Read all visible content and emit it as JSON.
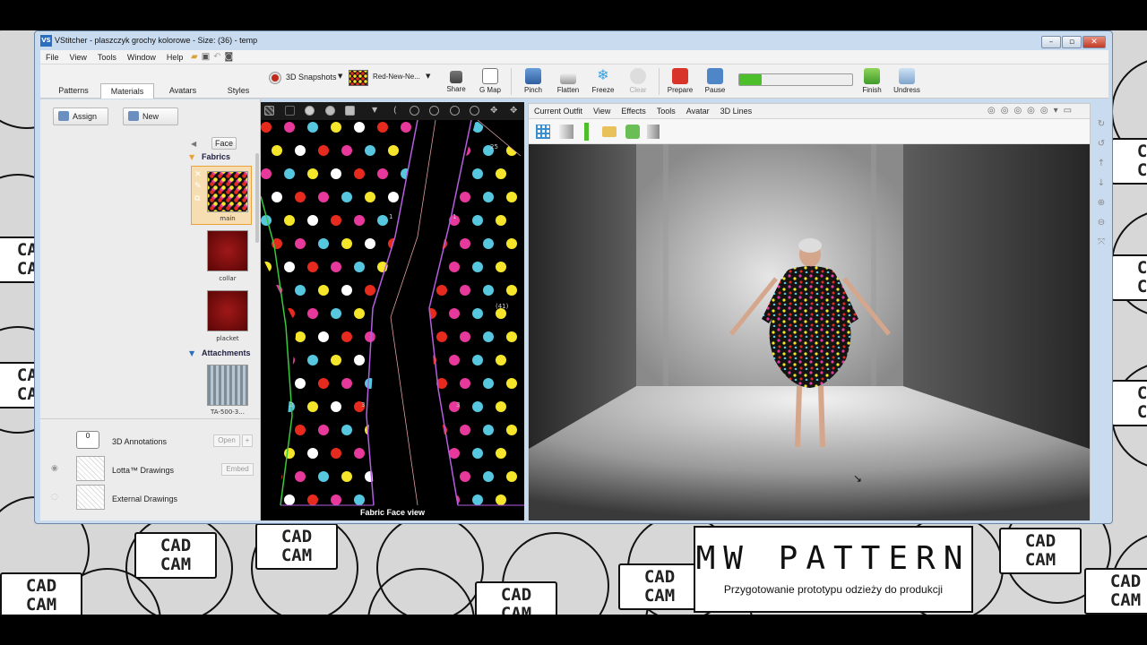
{
  "window": {
    "title": "VStitcher - plaszczyk grochy kolorowe - Size: (36) - temp",
    "icon": "VS"
  },
  "menu": [
    "File",
    "View",
    "Tools",
    "Window",
    "Help"
  ],
  "tabs": [
    "Patterns",
    "Materials",
    "Avatars",
    "Styles"
  ],
  "toolbar": {
    "snapshots": "3D Snapshots",
    "fabric_select": "Red-New-Ne...",
    "share": "Share",
    "gmap": "G Map",
    "pinch": "Pinch",
    "flatten": "Flatten",
    "freeze": "Freeze",
    "clear": "Clear",
    "prepare": "Prepare",
    "pause": "Pause",
    "finish": "Finish",
    "undress": "Undress",
    "progress": 0.2
  },
  "materials": {
    "assign": "Assign",
    "new": "New",
    "face": "Face",
    "fabrics_header": "Fabrics",
    "fabrics": [
      "main",
      "collar",
      "placket"
    ],
    "attachments_header": "Attachments",
    "attachment_label": "TA-500-3...",
    "annotations": {
      "label": "3D Annotations",
      "count": "0",
      "open": "Open",
      "plus": "+"
    },
    "lotta": {
      "label": "Lotta™ Drawings",
      "embed": "Embed"
    },
    "external": {
      "label": "External Drawings"
    }
  },
  "pattern_view": {
    "caption": "Fabric Face view",
    "nums": [
      "1",
      "2",
      "3",
      "1",
      "1",
      "3",
      "25",
      "(41)"
    ]
  },
  "view3d_menu": [
    "Current Outfit",
    "View",
    "Effects",
    "Tools",
    "Avatar",
    "3D Lines"
  ],
  "brand": {
    "title": "MW PATTERN",
    "subtitle": "Przygotowanie prototypu odzieży do produkcji"
  },
  "background_monitors": [
    "CAD",
    "CAM"
  ],
  "colors": {
    "accent": "#e8a23a",
    "dot_red": "#e62a1e",
    "dot_yellow": "#f6e62b",
    "dot_pink": "#e6399b",
    "dot_white": "#ffffff",
    "dot_cyan": "#57c7e0"
  }
}
